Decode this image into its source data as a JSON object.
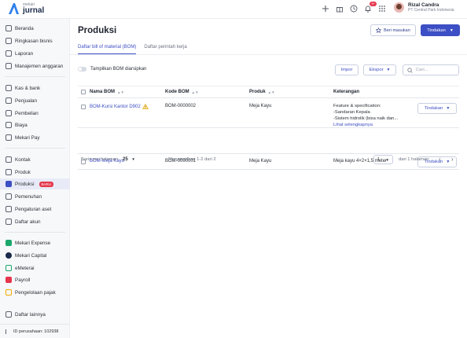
{
  "app": {
    "logo_small": "mekari",
    "logo_big": "jurnal"
  },
  "header": {
    "notification_count": "9+",
    "user_name": "Rizal Candra",
    "user_company": "PT Central Park Indonesia"
  },
  "sidebar": {
    "items": [
      {
        "label": "Beranda",
        "icon": "home-icon"
      },
      {
        "label": "Ringkasan bisnis",
        "icon": "summary-icon"
      },
      {
        "label": "Laporan",
        "icon": "report-icon"
      },
      {
        "label": "Manajemen anggaran",
        "icon": "budget-icon"
      },
      {
        "label": "Kas & bank",
        "icon": "bank-icon"
      },
      {
        "label": "Penjualan",
        "icon": "sales-icon"
      },
      {
        "label": "Pembelian",
        "icon": "purchase-icon"
      },
      {
        "label": "Biaya",
        "icon": "expense-icon"
      },
      {
        "label": "Mekari Pay",
        "icon": "pay-icon"
      },
      {
        "label": "Kontak",
        "icon": "contact-icon"
      },
      {
        "label": "Produk",
        "icon": "product-icon"
      },
      {
        "label": "Produksi",
        "icon": "production-icon",
        "badge": "BARU"
      },
      {
        "label": "Pemenuhan",
        "icon": "fulfillment-icon"
      },
      {
        "label": "Pengaturan aset",
        "icon": "asset-icon"
      },
      {
        "label": "Daftar akun",
        "icon": "account-icon"
      },
      {
        "label": "Mekari Expense",
        "icon": "mekari-expense-icon"
      },
      {
        "label": "Mekari Capital",
        "icon": "mekari-capital-icon"
      },
      {
        "label": "eMeterai",
        "icon": "emeterai-icon"
      },
      {
        "label": "Payroll",
        "icon": "payroll-icon"
      },
      {
        "label": "Pengelolaan pajak",
        "icon": "tax-icon"
      },
      {
        "label": "Daftar lainnya",
        "icon": "more-icon"
      }
    ],
    "footer": "ID perusahaan: 102938"
  },
  "page": {
    "title": "Produksi",
    "feedback_label": "Beri masukan",
    "action_label": "Tindakan",
    "tabs": [
      {
        "label": "Daftar bill of material (BOM)",
        "active": true
      },
      {
        "label": "Daftar perintah kerja",
        "active": false
      }
    ],
    "toggle_label": "Tampilkan BOM diarsipkan",
    "import_label": "Impor",
    "export_label": "Ekspor",
    "search_placeholder": "Cari..."
  },
  "table": {
    "columns": [
      "Nama BOM",
      "Kode BOM",
      "Produk",
      "Keterangan"
    ],
    "rows": [
      {
        "name": "BOM-Kursi Kantor D902",
        "warning": true,
        "code": "BOM-0000002",
        "product": "Meja Kayu",
        "desc_lines": [
          "Feature & specification:",
          "-Sandaran Kepala",
          "-Sistem hidrolik (bisa naik dan..."
        ],
        "see_more": "Lihat selengkapnya",
        "action": "Tindakan"
      },
      {
        "name": "BOM-Meja Kayu",
        "warning": false,
        "code": "BOM-0000001",
        "product": "Meja Kayu",
        "desc_lines": [
          "Meja kayu 4×2×1,5 meter"
        ],
        "see_more": "",
        "action": "Tindakan"
      }
    ]
  },
  "pagination": {
    "rows_per_page_label": "Baris per halaman",
    "rows_per_page": "25",
    "showing": "Menampilkan 1-2 dari 2",
    "page": "1",
    "of_pages": "dari 1 halaman"
  },
  "colors": {
    "primary": "#3d4fc4",
    "badge_red": "#e5364d"
  }
}
